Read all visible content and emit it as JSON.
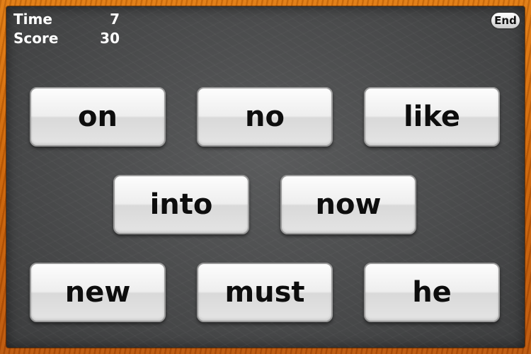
{
  "hud": {
    "time_label": "Time",
    "time_value": "7",
    "score_label": "Score",
    "score_value": "30"
  },
  "end_button": {
    "label": "End"
  },
  "words": [
    {
      "label": "on"
    },
    {
      "label": "no"
    },
    {
      "label": "like"
    },
    {
      "label": "into"
    },
    {
      "label": "now"
    },
    {
      "label": "new"
    },
    {
      "label": "must"
    },
    {
      "label": "he"
    }
  ],
  "colors": {
    "frame": "#c85f06",
    "board": "#4a4b4c",
    "tile": "#eeeeee",
    "text_light": "#ffffff",
    "text_dark": "#0d0d0d"
  }
}
